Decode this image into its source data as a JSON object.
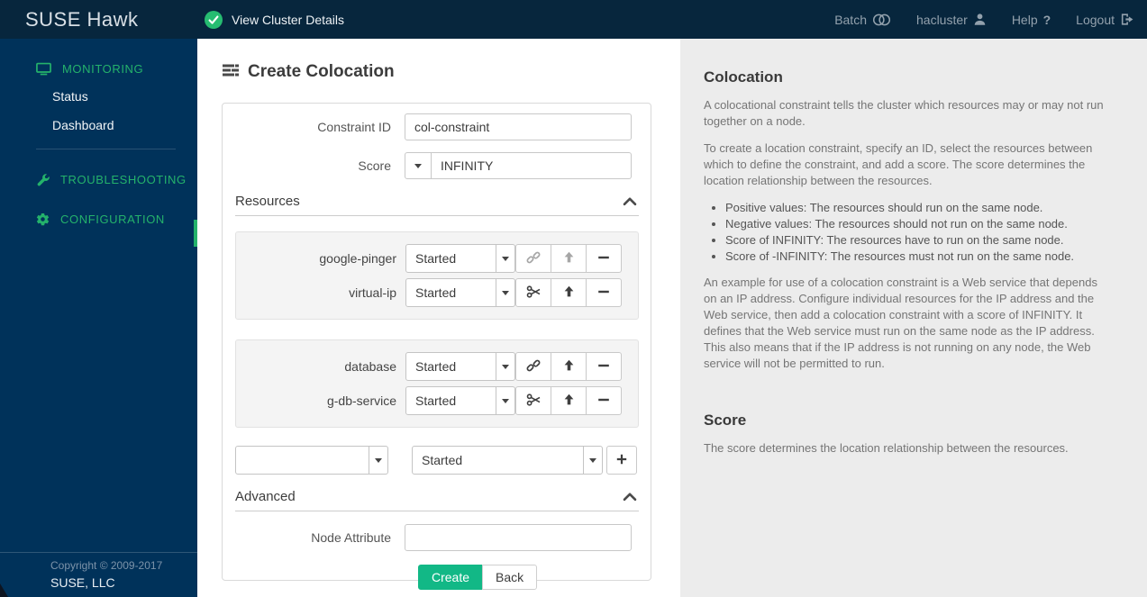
{
  "colors": {
    "topbar_bg": "#07263d",
    "sidebar_bg": "#00325a",
    "accent_green": "#24b26b",
    "create_button_green": "#12b886",
    "help_panel_bg": "#ececec"
  },
  "topbar": {
    "brand": "SUSE Hawk",
    "status": {
      "icon": "check-circle-icon",
      "label": "View Cluster Details"
    },
    "nav": [
      {
        "id": "batch",
        "label": "Batch",
        "icon": "batch-toggle-icon"
      },
      {
        "id": "user",
        "label": "hacluster",
        "icon": "user-icon"
      },
      {
        "id": "help",
        "label": "Help",
        "icon": "question-icon",
        "glyph": "?"
      },
      {
        "id": "logout",
        "label": "Logout",
        "icon": "logout-icon"
      }
    ]
  },
  "sidebar": {
    "sections": [
      {
        "id": "monitoring",
        "label": "MONITORING",
        "icon": "monitor-icon",
        "items": [
          {
            "id": "status",
            "label": "Status"
          },
          {
            "id": "dashboard",
            "label": "Dashboard"
          }
        ],
        "divider_after": true
      },
      {
        "id": "troubleshooting",
        "label": "TROUBLESHOOTING",
        "icon": "wrench-icon",
        "items": [],
        "divider_after": false
      },
      {
        "id": "configuration",
        "label": "CONFIGURATION",
        "icon": "gear-icon",
        "items": [],
        "divider_after": false
      }
    ],
    "footer": {
      "copyright": "Copyright © 2009-2017",
      "company": "SUSE, LLC"
    }
  },
  "main": {
    "title": "Create Colocation",
    "form": {
      "constraint_id": {
        "label": "Constraint ID",
        "value": "col-constraint"
      },
      "score": {
        "label": "Score",
        "value": "INFINITY"
      },
      "resources": {
        "section_label": "Resources",
        "groups": [
          {
            "rows": [
              {
                "name": "google-pinger",
                "state": "Started",
                "action": "link",
                "action_muted": true,
                "up_muted": true
              },
              {
                "name": "virtual-ip",
                "state": "Started",
                "action": "scissors",
                "action_muted": false,
                "up_muted": false
              }
            ]
          },
          {
            "rows": [
              {
                "name": "database",
                "state": "Started",
                "action": "link",
                "action_muted": false,
                "up_muted": false
              },
              {
                "name": "g-db-service",
                "state": "Started",
                "action": "scissors",
                "action_muted": false,
                "up_muted": false
              }
            ]
          }
        ],
        "add_row": {
          "resource_value": "",
          "state": "Started"
        }
      },
      "advanced": {
        "section_label": "Advanced",
        "node_attribute": {
          "label": "Node Attribute",
          "value": ""
        }
      },
      "buttons": {
        "create": "Create",
        "back": "Back"
      }
    }
  },
  "help": {
    "colocation": {
      "title": "Colocation",
      "paragraphs_before_bullets": [
        "A colocational constraint tells the cluster which resources may or may not run together on a node.",
        "To create a location constraint, specify an ID, select the resources between which to define the constraint, and add a score. The score determines the location relationship between the resources."
      ],
      "bullets": [
        "Positive values: The resources should run on the same node.",
        "Negative values: The resources should not run on the same node.",
        "Score of INFINITY: The resources have to run on the same node.",
        "Score of -INFINITY: The resources must not run on the same node."
      ],
      "paragraphs_after_bullets": [
        "An example for use of a colocation constraint is a Web service that depends on an IP address. Configure individual resources for the IP address and the Web service, then add a colocation constraint with a score of INFINITY. It defines that the Web service must run on the same node as the IP address. This also means that if the IP address is not running on any node, the Web service will not be permitted to run."
      ]
    },
    "score": {
      "title": "Score",
      "text": "The score determines the location relationship between the resources."
    }
  }
}
